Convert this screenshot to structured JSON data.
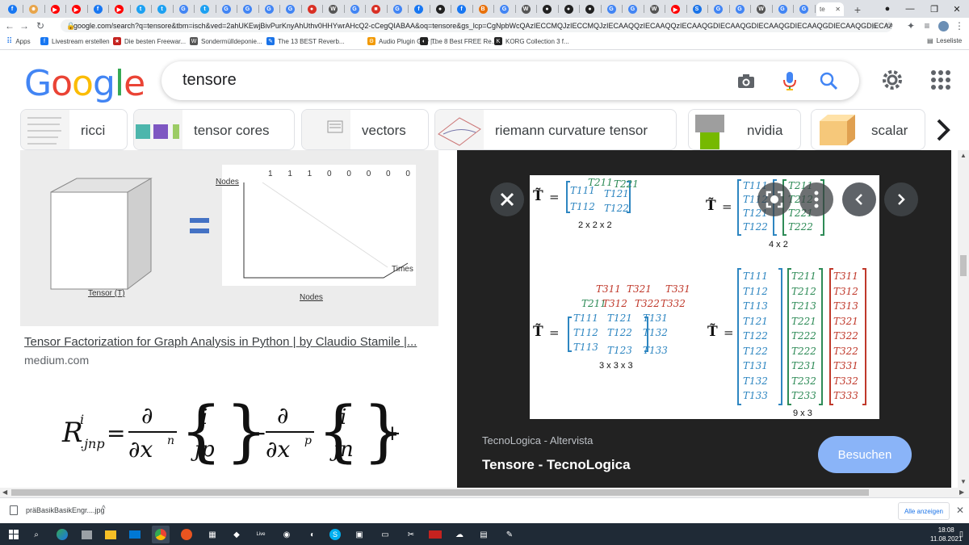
{
  "browser": {
    "url": "google.com/search?q=tensore&tbm=isch&ved=2ahUKEwjBivPurKnyAhUthv0HHYwrAHcQ2-cCegQIABAA&oq=tensore&gs_lcp=CgNpbWcQAzIECCMQJzIECCMQJzIECAAQQzIECAAQQzIECAAQGDIECAAQGDIECAAQGDIECAAQGDIECAAQGDIECAAQGDIECAAQGFC...",
    "active_tab_label": "te",
    "new_tab_symbol": "+",
    "tab_icons": [
      {
        "name": "facebook-icon",
        "color": "#1877f2",
        "glyph": "f"
      },
      {
        "name": "user-icon",
        "color": "#e8a54b",
        "glyph": "☻"
      },
      {
        "name": "youtube-icon",
        "color": "#ff0000",
        "glyph": "▶"
      },
      {
        "name": "youtube-icon",
        "color": "#ff0000",
        "glyph": "▶"
      },
      {
        "name": "facebook-icon",
        "color": "#1877f2",
        "glyph": "f"
      },
      {
        "name": "youtube-icon",
        "color": "#ff0000",
        "glyph": "▶"
      },
      {
        "name": "twitter-icon",
        "color": "#1da1f2",
        "glyph": "t"
      },
      {
        "name": "twitter-icon",
        "color": "#1da1f2",
        "glyph": "t"
      },
      {
        "name": "google-icon",
        "color": "#4285f4",
        "glyph": "G"
      },
      {
        "name": "twitter-icon",
        "color": "#1da1f2",
        "glyph": "t"
      },
      {
        "name": "google-icon",
        "color": "#4285f4",
        "glyph": "G"
      },
      {
        "name": "google-icon",
        "color": "#4285f4",
        "glyph": "G"
      },
      {
        "name": "google-icon",
        "color": "#4285f4",
        "glyph": "G"
      },
      {
        "name": "google-icon",
        "color": "#4285f4",
        "glyph": "G"
      },
      {
        "name": "site-icon",
        "color": "#d93025",
        "glyph": "●"
      },
      {
        "name": "wikipedia-icon",
        "color": "#555555",
        "glyph": "W"
      },
      {
        "name": "google-icon",
        "color": "#4285f4",
        "glyph": "G"
      },
      {
        "name": "site-icon",
        "color": "#d93025",
        "glyph": "■"
      },
      {
        "name": "google-icon",
        "color": "#4285f4",
        "glyph": "G"
      },
      {
        "name": "facebook-icon",
        "color": "#1877f2",
        "glyph": "f"
      },
      {
        "name": "github-icon",
        "color": "#222222",
        "glyph": "●"
      },
      {
        "name": "facebook-icon",
        "color": "#1877f2",
        "glyph": "f"
      },
      {
        "name": "site-icon",
        "color": "#e8710a",
        "glyph": "B"
      },
      {
        "name": "google-icon",
        "color": "#4285f4",
        "glyph": "G"
      },
      {
        "name": "wikipedia-icon",
        "color": "#555555",
        "glyph": "W"
      },
      {
        "name": "github-icon",
        "color": "#222222",
        "glyph": "●"
      },
      {
        "name": "github-icon",
        "color": "#222222",
        "glyph": "●"
      },
      {
        "name": "github-icon",
        "color": "#222222",
        "glyph": "●"
      },
      {
        "name": "google-icon",
        "color": "#4285f4",
        "glyph": "G"
      },
      {
        "name": "google-icon",
        "color": "#4285f4",
        "glyph": "G"
      },
      {
        "name": "wikipedia-icon",
        "color": "#555555",
        "glyph": "W"
      },
      {
        "name": "youtube-icon",
        "color": "#ff0000",
        "glyph": "▶"
      },
      {
        "name": "site-icon",
        "color": "#1a73e8",
        "glyph": "S"
      },
      {
        "name": "google-icon",
        "color": "#4285f4",
        "glyph": "G"
      },
      {
        "name": "google-icon",
        "color": "#4285f4",
        "glyph": "G"
      },
      {
        "name": "wikipedia-icon",
        "color": "#555555",
        "glyph": "W"
      },
      {
        "name": "google-icon",
        "color": "#4285f4",
        "glyph": "G"
      },
      {
        "name": "google-icon",
        "color": "#4285f4",
        "glyph": "G"
      }
    ]
  },
  "bookmarks": {
    "apps": "Apps",
    "items": [
      {
        "label": "Livestream erstellen",
        "icon": "facebook-icon",
        "color": "#1877f2",
        "glyph": "f"
      },
      {
        "label": "Die besten Freewar...",
        "icon": "star-icon",
        "color": "#c5221f",
        "glyph": "★"
      },
      {
        "label": "Sondermülldeponie...",
        "icon": "wikipedia-icon",
        "color": "#555555",
        "glyph": "W"
      },
      {
        "label": "The 13 BEST Reverb...",
        "icon": "site-icon",
        "color": "#1a73e8",
        "glyph": "✎"
      },
      {
        "label": "Audio Plugin Guy |...",
        "icon": "site-icon",
        "color": "#f29900",
        "glyph": "⚙"
      },
      {
        "label": "The 8 Best FREE Re...",
        "icon": "site-icon",
        "color": "#222222",
        "glyph": "◐"
      },
      {
        "label": "KORG Collection 3 f...",
        "icon": "site-icon",
        "color": "#222222",
        "glyph": "K"
      }
    ],
    "reading_list": "Leseliste"
  },
  "search": {
    "query": "tensore",
    "logo_letters": [
      {
        "ch": "G",
        "color": "#4285f4"
      },
      {
        "ch": "o",
        "color": "#ea4335"
      },
      {
        "ch": "o",
        "color": "#fbbc05"
      },
      {
        "ch": "g",
        "color": "#4285f4"
      },
      {
        "ch": "l",
        "color": "#34a853"
      },
      {
        "ch": "e",
        "color": "#ea4335"
      }
    ]
  },
  "chips": [
    {
      "label": "ricci"
    },
    {
      "label": "tensor cores"
    },
    {
      "label": "vectors"
    },
    {
      "label": "riemann curvature tensor"
    },
    {
      "label": "nvidia"
    },
    {
      "label": "scalar"
    }
  ],
  "results": [
    {
      "title": "Tensor Factorization for Graph Analysis in Python | by Claudio Stamile |...",
      "source": "medium.com",
      "image_labels": {
        "tensor": "Tensor (T)",
        "nodes_top": "Nodes",
        "nodes_bottom": "Nodes",
        "times": "Times"
      },
      "matrix_top_row": "1 1 1 0 0 0 0 0"
    },
    {
      "formula_parts": {
        "R": "R",
        "sup": "i",
        "sub": ".jnp",
        "d": "∂",
        "dxn": "∂x",
        "n": "n",
        "dxp": "∂x",
        "p": "p",
        "i": "i",
        "jp": "jp",
        "jn": "jn",
        "eq": "=",
        "minus": "−",
        "plus": "+"
      }
    }
  ],
  "preview": {
    "source": "TecnoLogica - Altervista",
    "title": "Tensore - TecnoLogica",
    "visit": "Besuchen",
    "dims": {
      "a": "2 x 2 x 2",
      "b": "4 x 2",
      "c": "3 x 3 x 3",
      "d": "9 x 3"
    },
    "T": "T̃",
    "eq": "="
  },
  "download": {
    "filename": "präBasikBasikEngr....jpg",
    "show_all": "Alle anzeigen"
  },
  "taskbar": {
    "time": "18:08",
    "date": "11.08.2021"
  }
}
